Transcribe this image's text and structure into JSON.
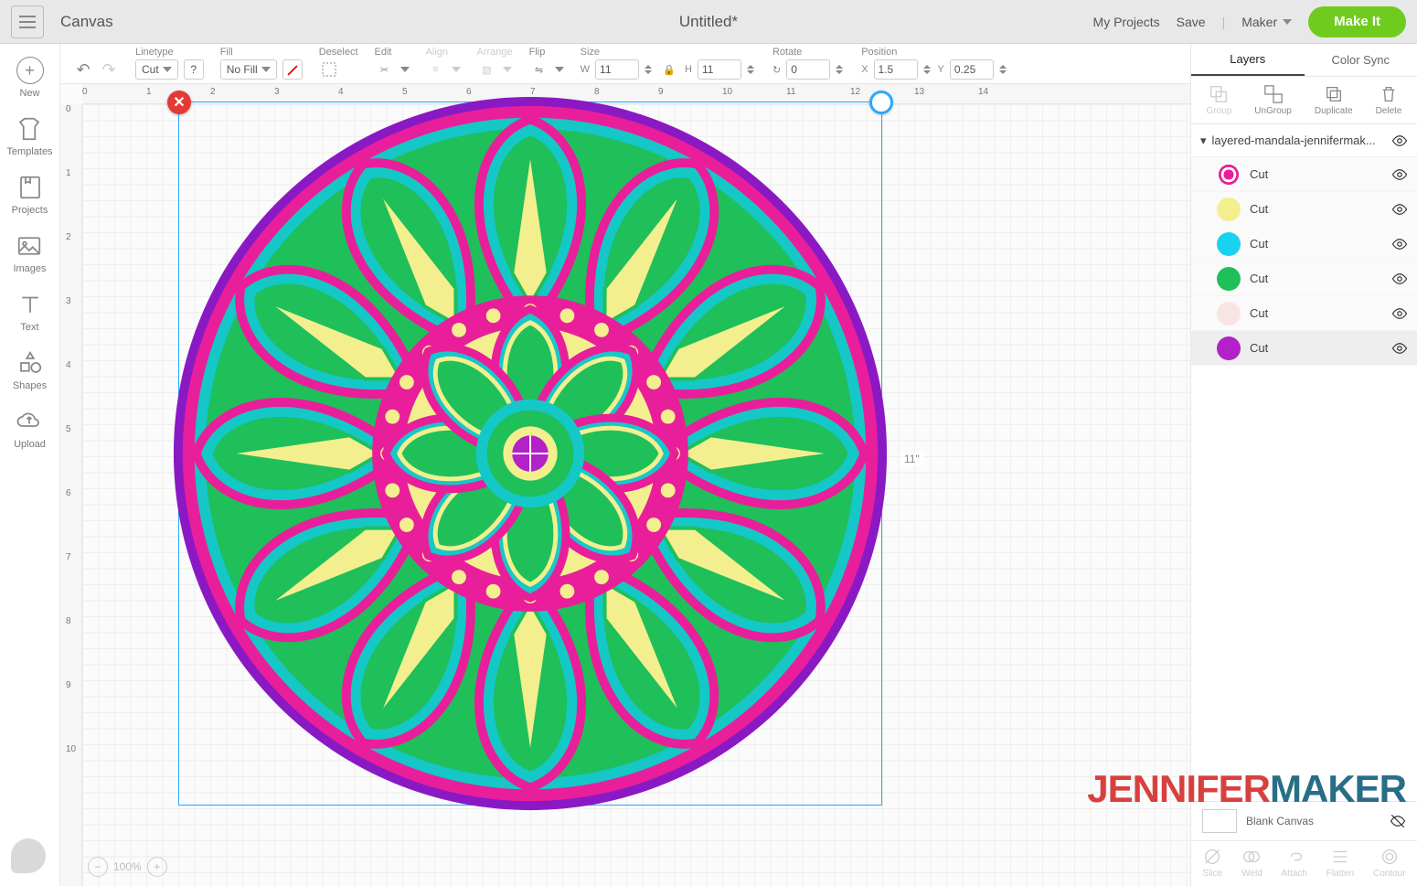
{
  "header": {
    "app_title": "Canvas",
    "doc_title": "Untitled*",
    "my_projects": "My Projects",
    "save": "Save",
    "machine": "Maker",
    "make_it": "Make It"
  },
  "leftbar": {
    "new": "New",
    "templates": "Templates",
    "projects": "Projects",
    "images": "Images",
    "text": "Text",
    "shapes": "Shapes",
    "upload": "Upload"
  },
  "propbar": {
    "linetype_label": "Linetype",
    "linetype_value": "Cut",
    "fill_label": "Fill",
    "fill_value": "No Fill",
    "deselect": "Deselect",
    "edit": "Edit",
    "align": "Align",
    "arrange": "Arrange",
    "flip": "Flip",
    "size": "Size",
    "size_w_label": "W",
    "size_w": "11",
    "size_h_label": "H",
    "size_h": "11",
    "rotate_label": "Rotate",
    "rotate_sym": "↻",
    "rotate": "0",
    "position_label": "Position",
    "pos_x_label": "X",
    "pos_x": "1.5",
    "pos_y_label": "Y",
    "pos_y": "0.25"
  },
  "canvas": {
    "ruler_h": [
      "0",
      "1",
      "2",
      "3",
      "4",
      "5",
      "6",
      "7",
      "8",
      "9",
      "10",
      "11",
      "12",
      "13",
      "14"
    ],
    "ruler_v": [
      "0",
      "1",
      "2",
      "3",
      "4",
      "5",
      "6",
      "7",
      "8",
      "9",
      "10"
    ],
    "sel_dim": "11\"",
    "zoom": "100%"
  },
  "rpanel": {
    "tab_layers": "Layers",
    "tab_colorsync": "Color Sync",
    "action_group": "Group",
    "action_ungroup": "UnGroup",
    "action_duplicate": "Duplicate",
    "action_delete": "Delete",
    "group_name": "layered-mandala-jennifermak...",
    "layer_label": "Cut",
    "layers": [
      {
        "color": "#e91e9b",
        "pattern": true
      },
      {
        "color": "#f3ef8f"
      },
      {
        "color": "#19d2f0"
      },
      {
        "color": "#1fbf5a"
      },
      {
        "color": "#f9e4e4"
      },
      {
        "color": "#b321c9"
      }
    ],
    "blank_canvas": "Blank Canvas",
    "foot_slice": "Slice",
    "foot_weld": "Weld",
    "foot_attach": "Attach",
    "foot_flatten": "Flatten",
    "foot_contour": "Contour"
  },
  "watermark": {
    "a": "JENNIFER",
    "b": "MAKER"
  }
}
